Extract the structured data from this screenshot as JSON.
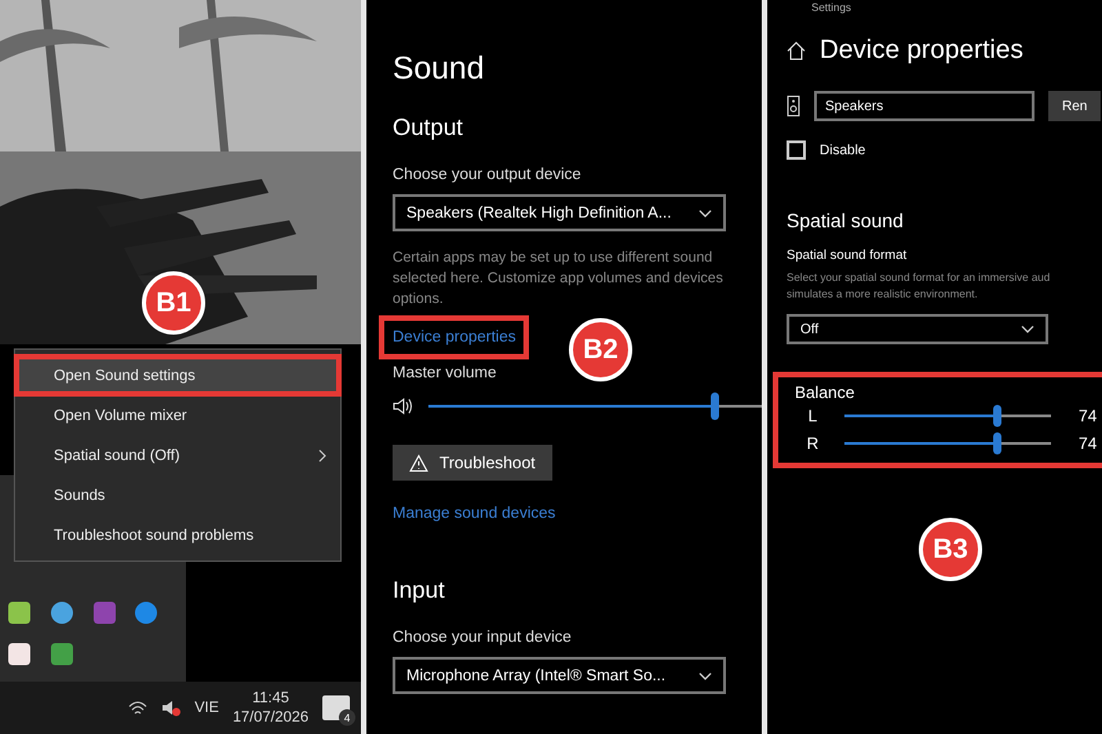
{
  "taskbar_panel": {
    "menu": [
      {
        "label": "Open Sound settings",
        "highlighted": true,
        "submenu": false
      },
      {
        "label": "Open Volume mixer",
        "highlighted": false,
        "submenu": false
      },
      {
        "label": "Spatial sound (Off)",
        "highlighted": false,
        "submenu": true
      },
      {
        "label": "Sounds",
        "highlighted": false,
        "submenu": false
      },
      {
        "label": "Troubleshoot sound problems",
        "highlighted": false,
        "submenu": false
      }
    ],
    "step_badge": "B1",
    "language": "VIE",
    "time": "11:45",
    "date": "17/07/2026",
    "notification_count": "4"
  },
  "sound_panel": {
    "title": "Sound",
    "output_heading": "Output",
    "output_label": "Choose your output device",
    "output_device": "Speakers (Realtek High Definition A...",
    "note": "Certain apps may be set up to use different sound\nselected here. Customize app volumes and devices\noptions.",
    "device_properties_link": {
      "label": "Device properties",
      "highlighted": true
    },
    "step_badge": "B2",
    "master_volume_label": "Master volume",
    "master_volume": {
      "level": 0.83
    },
    "troubleshoot_button": "Troubleshoot",
    "manage_link": "Manage sound devices",
    "input_heading": "Input",
    "input_label": "Choose your input device",
    "input_device": "Microphone Array (Intel® Smart So..."
  },
  "device_panel": {
    "header": "Settings",
    "title": "Device properties",
    "name_value": "Speakers",
    "rename_button": "Ren",
    "disable": {
      "label": "Disable",
      "checked": false
    },
    "spatial_heading": "Spatial sound",
    "format_label": "Spatial sound format",
    "format_note": "Select your spatial sound format for an immersive aud\nsimulates a more realistic environment.",
    "format_value": "Off",
    "balance": {
      "label": "Balance",
      "highlighted": true,
      "channels": [
        {
          "name": "L",
          "level": 0.74,
          "reading": "74"
        },
        {
          "name": "R",
          "level": 0.74,
          "reading": "74"
        }
      ]
    },
    "step_badge": "B3"
  }
}
